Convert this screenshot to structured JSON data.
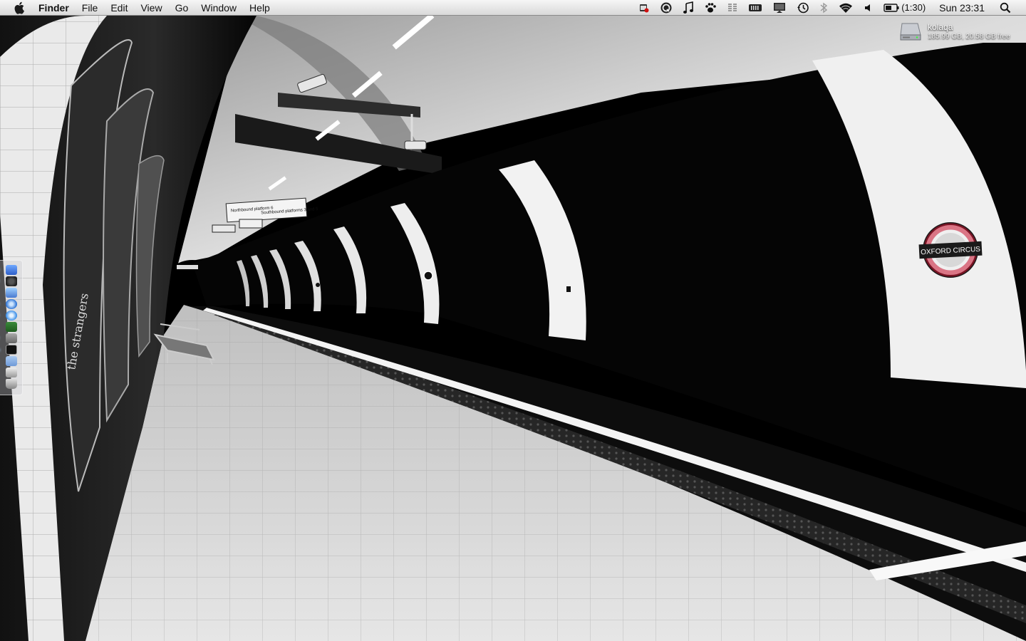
{
  "menubar": {
    "app_name": "Finder",
    "menus": [
      "File",
      "Edit",
      "View",
      "Go",
      "Window",
      "Help"
    ],
    "battery_time": "(1:30)",
    "clock": "Sun 23:31"
  },
  "status_icons": [
    "calendar-badge-icon",
    "quicksilver-icon",
    "itunes-note-icon",
    "growl-paw-icon",
    "menu-meters-icon",
    "memory-icon",
    "display-icon",
    "time-machine-icon",
    "bluetooth-icon",
    "wifi-icon",
    "volume-icon",
    "battery-icon",
    "spotlight-icon"
  ],
  "desktop": {
    "disk": {
      "name": "kolaqa",
      "info": "185.99 GB, 20.58 GB free"
    }
  },
  "wallpaper": {
    "roundel_text": "OXFORD CIRCUS",
    "sign_north": "Northbound platform 6",
    "sign_south": "Southbound platforms 3 and 5",
    "poster_text": "the strangers"
  },
  "dock": {
    "items": [
      {
        "icon": "finder-icon",
        "running": true
      },
      {
        "icon": "dashboard-icon",
        "running": true
      },
      {
        "icon": "preview-icon",
        "running": false
      },
      {
        "icon": "safari-icon",
        "running": true
      },
      {
        "icon": "itunes-icon",
        "running": true
      },
      {
        "icon": "network-icon",
        "running": false
      },
      {
        "icon": "utilities-icon",
        "running": true
      },
      {
        "icon": "terminal-icon",
        "running": true
      },
      {
        "icon": "folder-icon",
        "running": false
      },
      {
        "icon": "print-icon",
        "running": false
      },
      {
        "icon": "trash-icon",
        "running": false
      }
    ]
  },
  "colors": {
    "roundel_red": "#c8102e",
    "roundel_blue": "#0019a8",
    "dock_indicator": "#7ab8ff"
  }
}
